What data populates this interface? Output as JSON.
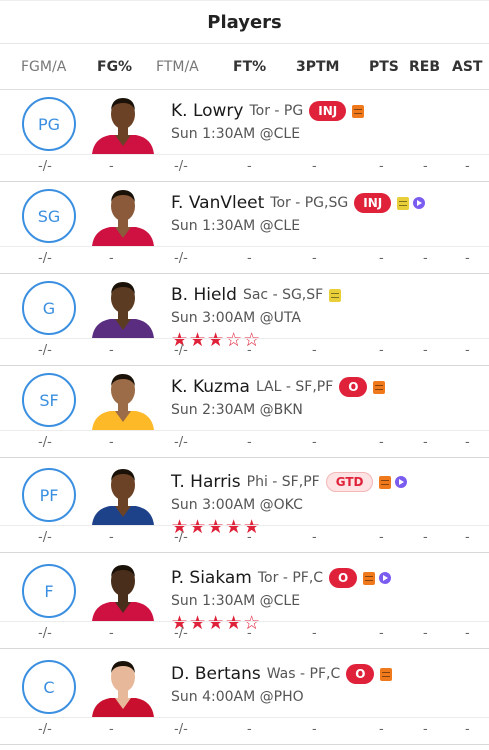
{
  "header": {
    "title": "Players"
  },
  "columns": [
    "FGM/A",
    "FG%",
    "FTM/A",
    "FT%",
    "3PTM",
    "PTS",
    "REB",
    "AST"
  ],
  "stats_row": [
    "-/-",
    "-",
    "-/-",
    "-",
    "-",
    "-",
    "-",
    "-"
  ],
  "players": [
    {
      "position": "PG",
      "name": "K. Lowry",
      "team_pos": "Tor - PG",
      "status": "INJ",
      "game": "Sun 1:30AM @CLE",
      "note": "orange",
      "video": false,
      "stars": "",
      "jersey": "#ce1141",
      "skin": "#6b4226"
    },
    {
      "position": "SG",
      "name": "F. VanVleet",
      "team_pos": "Tor - PG,SG",
      "status": "INJ",
      "game": "Sun 1:30AM @CLE",
      "note": "yellow",
      "video": true,
      "stars": "",
      "jersey": "#ce1141",
      "skin": "#8a5a3b"
    },
    {
      "position": "G",
      "name": "B. Hield",
      "team_pos": "Sac - SG,SF",
      "status": "",
      "game": "Sun 3:00AM @UTA",
      "note": "yellow",
      "video": false,
      "stars": "★★★☆☆",
      "jersey": "#5a2d81",
      "skin": "#5c3b23"
    },
    {
      "position": "SF",
      "name": "K. Kuzma",
      "team_pos": "LAL - SF,PF",
      "status": "O",
      "game": "Sun 2:30AM @BKN",
      "note": "orange",
      "video": false,
      "stars": "",
      "jersey": "#fdb927",
      "skin": "#9c6b47"
    },
    {
      "position": "PF",
      "name": "T. Harris",
      "team_pos": "Phi - SF,PF",
      "status": "GTD",
      "game": "Sun 3:00AM @OKC",
      "note": "orange",
      "video": true,
      "stars": "★★★★★",
      "jersey": "#1d428a",
      "skin": "#6b4226"
    },
    {
      "position": "F",
      "name": "P. Siakam",
      "team_pos": "Tor - PF,C",
      "status": "O",
      "game": "Sun 1:30AM @CLE",
      "note": "orange",
      "video": true,
      "stars": "★★★★☆",
      "jersey": "#ce1141",
      "skin": "#4a2e1c"
    },
    {
      "position": "C",
      "name": "D. Bertans",
      "team_pos": "Was - PF,C",
      "status": "O",
      "game": "Sun 4:00AM @PHO",
      "note": "orange",
      "video": false,
      "stars": "",
      "jersey": "#c8102e",
      "skin": "#e7b99a"
    }
  ]
}
